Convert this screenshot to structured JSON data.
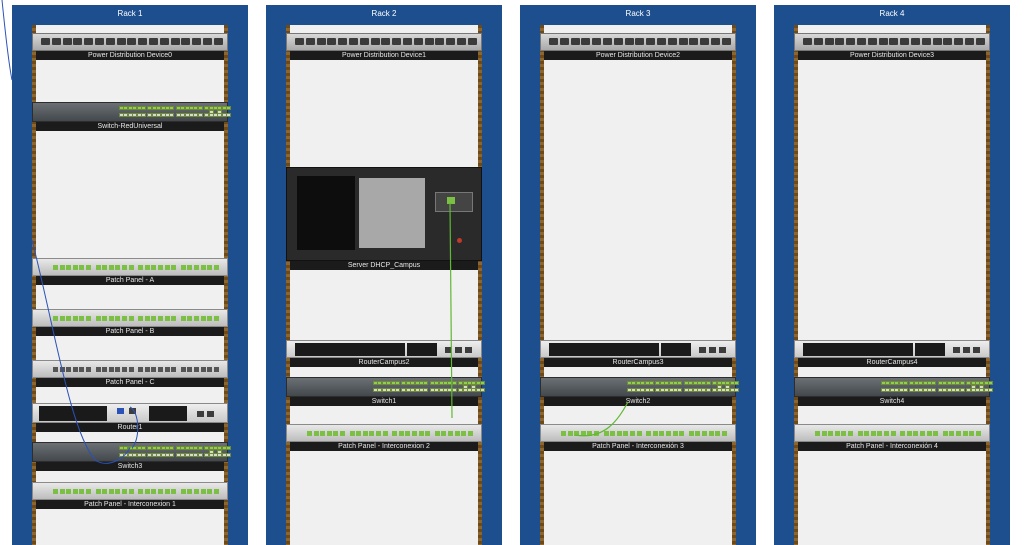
{
  "racks": [
    {
      "title": "Rack 1",
      "devices": {
        "pdu": "Power Distribution Device0",
        "switch_a": "Switch-RedUniversal",
        "patch_a": "Patch Panel - A",
        "patch_b": "Patch Panel - B",
        "patch_c": "Patch Panel - C",
        "router": "Router1",
        "switch_b": "Switch3",
        "patch_i": "Patch Panel - Interconexion 1"
      }
    },
    {
      "title": "Rack 2",
      "devices": {
        "pdu": "Power Distribution Device1",
        "server": "Server DHCP_Campus",
        "router": "RouterCampus2",
        "switch": "Switch1",
        "patch_i": "Patch Panel - Interconexion 2"
      }
    },
    {
      "title": "Rack 3",
      "devices": {
        "pdu": "Power Distribution Device2",
        "router": "RouterCampus3",
        "switch": "Switch2",
        "patch_i": "Patch Panel - Interconexión 3"
      }
    },
    {
      "title": "Rack 4",
      "devices": {
        "pdu": "Power Distribution Device3",
        "router": "RouterCampus4",
        "switch": "Switch4",
        "patch_i": "Patch Panel - Interconexión 4"
      }
    }
  ],
  "colors": {
    "rack_frame": "#1d4f8f",
    "copper_cable": "#5fb832",
    "serial_cable": "#2a52b8"
  }
}
